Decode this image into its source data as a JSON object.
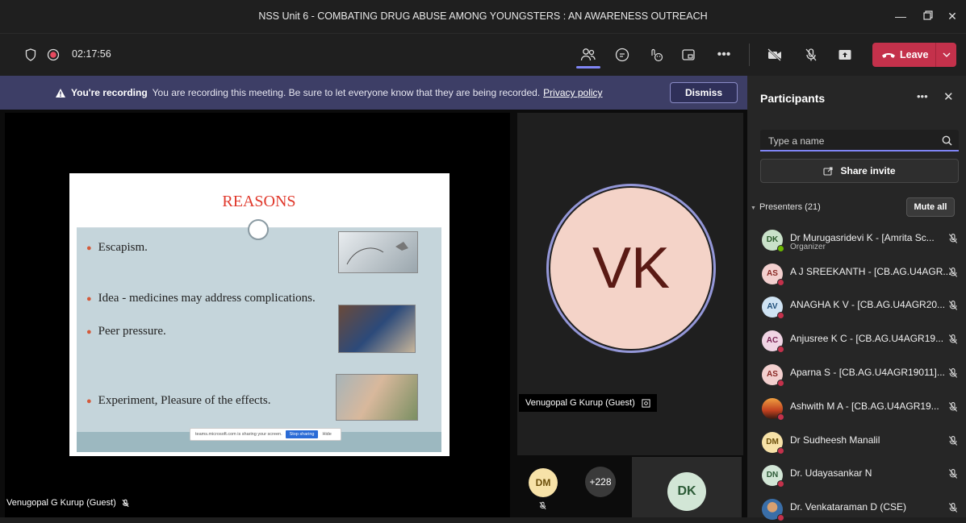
{
  "window": {
    "title": "NSS Unit 6 - COMBATING DRUG ABUSE AMONG YOUNGSTERS : AN AWARENESS OUTREACH"
  },
  "toolbar": {
    "timer": "02:17:56",
    "leave_label": "Leave",
    "accent": "#c4314b"
  },
  "banner": {
    "bold": "You're recording",
    "message": "You are recording this meeting. Be sure to let everyone know that they are being recorded.",
    "link": "Privacy policy",
    "dismiss": "Dismiss"
  },
  "slide": {
    "title": "REASONS",
    "bullets": [
      "Escapism.",
      "Idea - medicines may address complications.",
      "Peer pressure.",
      "Experiment, Pleasure of the effects."
    ],
    "share_notice": "teams.microsoft.com is sharing your screen.",
    "stop_sharing": "Stop sharing",
    "hide": "Hide"
  },
  "stage": {
    "presenter_name": "Venugopal G Kurup (Guest)",
    "vk_initials": "VK",
    "vk_name": "Venugopal G Kurup (Guest)",
    "dm_initials": "DM",
    "overflow": "+228",
    "dk_initials": "DK"
  },
  "panel": {
    "title": "Participants",
    "search_placeholder": "Type a name",
    "share_invite": "Share invite",
    "section": "Presenters (21)",
    "mute_all": "Mute all",
    "participants": [
      {
        "initials": "DK",
        "name": "Dr Murugasridevi K - [Amrita Sc...",
        "sub": "Organizer",
        "color": "#c9e1c9",
        "text": "#2b5a2b",
        "status": "#6bb700"
      },
      {
        "initials": "AS",
        "name": "A J SREEKANTH - [CB.AG.U4AGR...",
        "sub": "",
        "color": "#f3d0cf",
        "text": "#8a2a26",
        "status": "#c4314b"
      },
      {
        "initials": "AV",
        "name": "ANAGHA K V - [CB.AG.U4AGR20...",
        "sub": "",
        "color": "#cfe3f3",
        "text": "#1f4f7a",
        "status": "#c4314b"
      },
      {
        "initials": "AC",
        "name": "Anjusree K C - [CB.AG.U4AGR19...",
        "sub": "",
        "color": "#f0d4e4",
        "text": "#7a2455",
        "status": "#c4314b"
      },
      {
        "initials": "AS",
        "name": "Aparna S - [CB.AG.U4AGR19011]...",
        "sub": "",
        "color": "#f3d0cf",
        "text": "#8a2a26",
        "status": "#c4314b"
      },
      {
        "initials": "",
        "name": "Ashwith M A - [CB.AG.U4AGR19...",
        "sub": "",
        "color": "#d96a2a",
        "text": "#fff",
        "status": "#c4314b"
      },
      {
        "initials": "DM",
        "name": "Dr Sudheesh Manalil",
        "sub": "",
        "color": "#f7e2a8",
        "text": "#6b4e0a",
        "status": "#c4314b"
      },
      {
        "initials": "DN",
        "name": "Dr. Udayasankar N",
        "sub": "",
        "color": "#d2e6d6",
        "text": "#2b5a36",
        "status": "#c4314b"
      },
      {
        "initials": "",
        "name": "Dr. Venkataraman D (CSE)",
        "sub": "",
        "color": "#3a6ea8",
        "text": "#fff",
        "status": "#c4314b"
      }
    ]
  }
}
